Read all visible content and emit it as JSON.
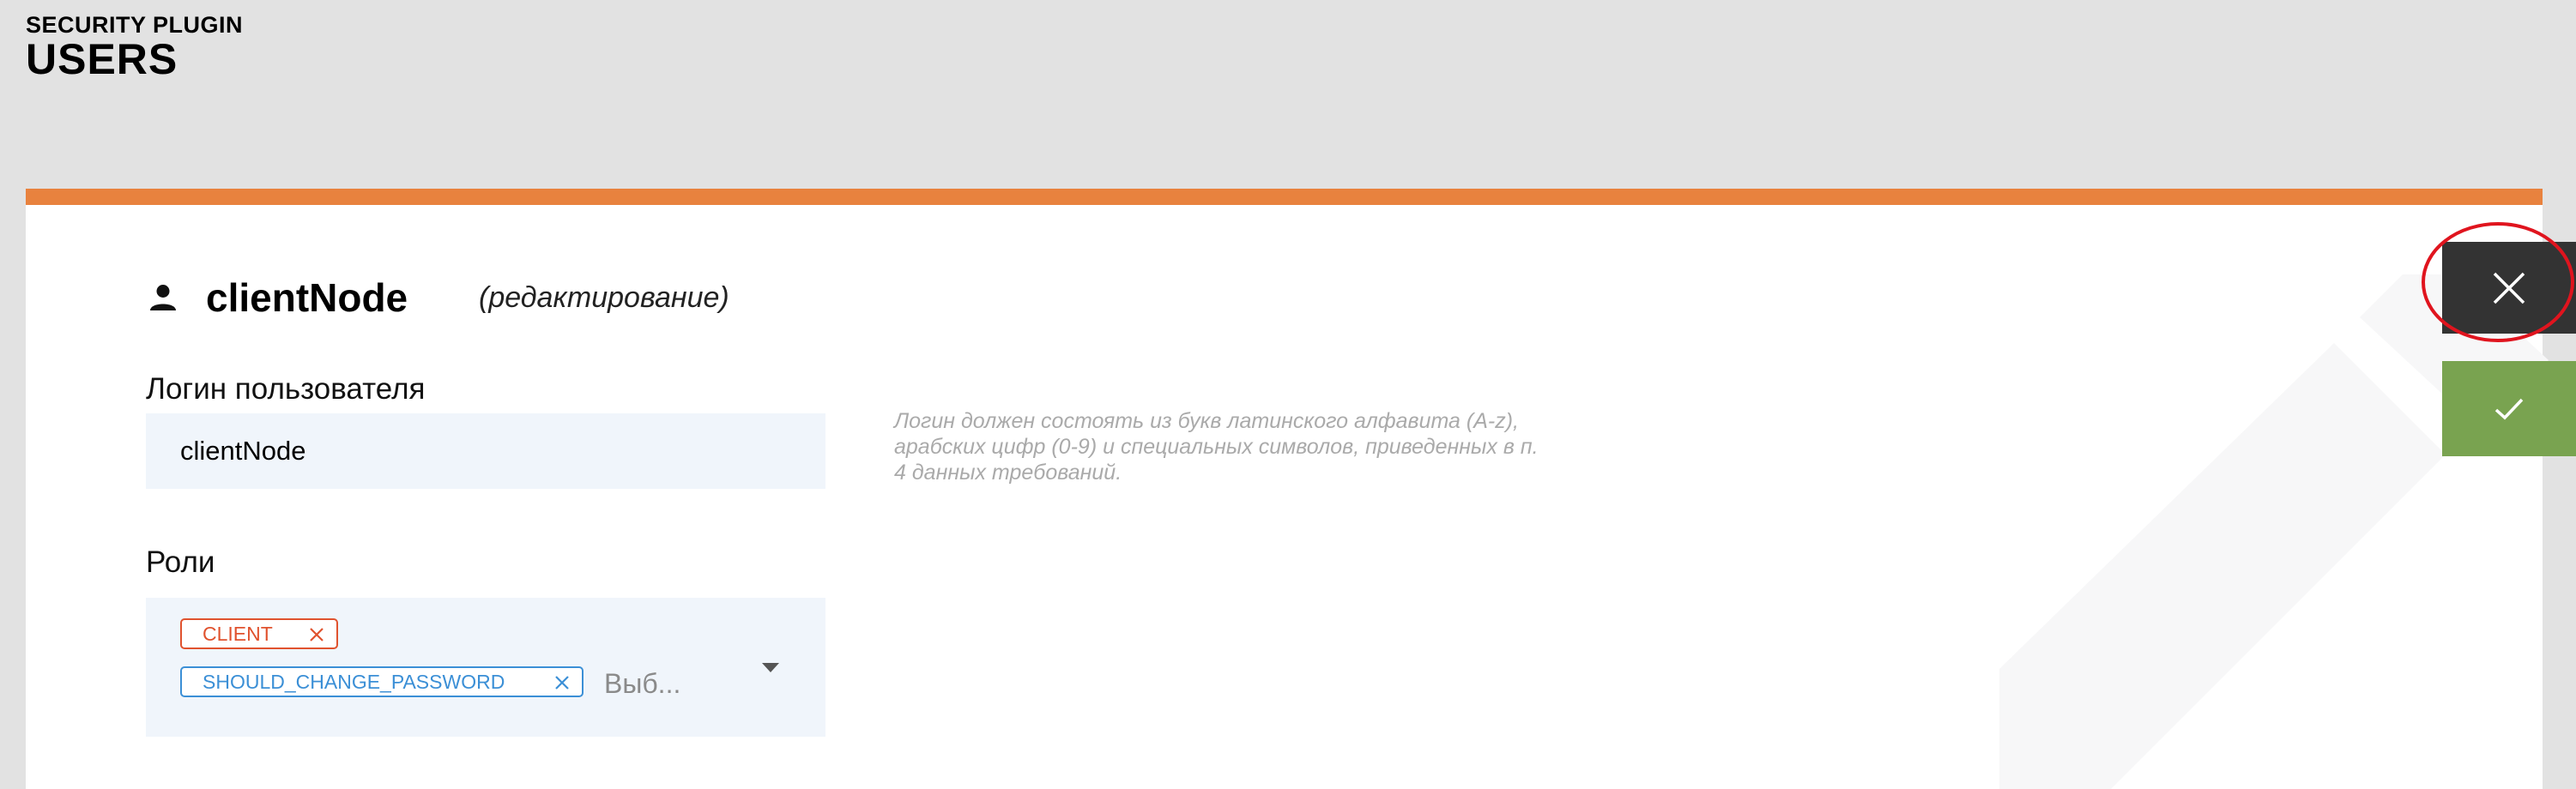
{
  "header": {
    "subtitle": "SECURITY PLUGIN",
    "title": "USERS"
  },
  "editor": {
    "user_icon": "person-icon",
    "username": "clientNode",
    "mode": "(редактирование)",
    "accent_color": "#e8823e",
    "login": {
      "label": "Логин пользователя",
      "value": "clientNode"
    },
    "hint": {
      "line1": "Логин должен состоять из букв латинского алфавита (A-z),",
      "line2": "арабских цифр (0-9) и специальных символов, приведенных в п.",
      "line3": "4 данных требований."
    },
    "roles": {
      "label": "Роли",
      "selected": [
        {
          "name": "CLIENT",
          "color": "#e0522e",
          "remove_icon": "close-icon"
        },
        {
          "name": "SHOULD_CHANGE_PASSWORD",
          "color": "#3b8fd6",
          "remove_icon": "close-icon"
        }
      ],
      "placeholder": "Выб...",
      "dropdown_icon": "caret-down-icon"
    },
    "watermark_icon": "pencil-icon"
  },
  "actions": {
    "cancel": {
      "icon": "close-icon",
      "color": "#333333"
    },
    "confirm": {
      "icon": "check-icon",
      "color": "#79a350"
    },
    "highlight": {
      "shape": "circle",
      "color": "#e0141e"
    }
  }
}
